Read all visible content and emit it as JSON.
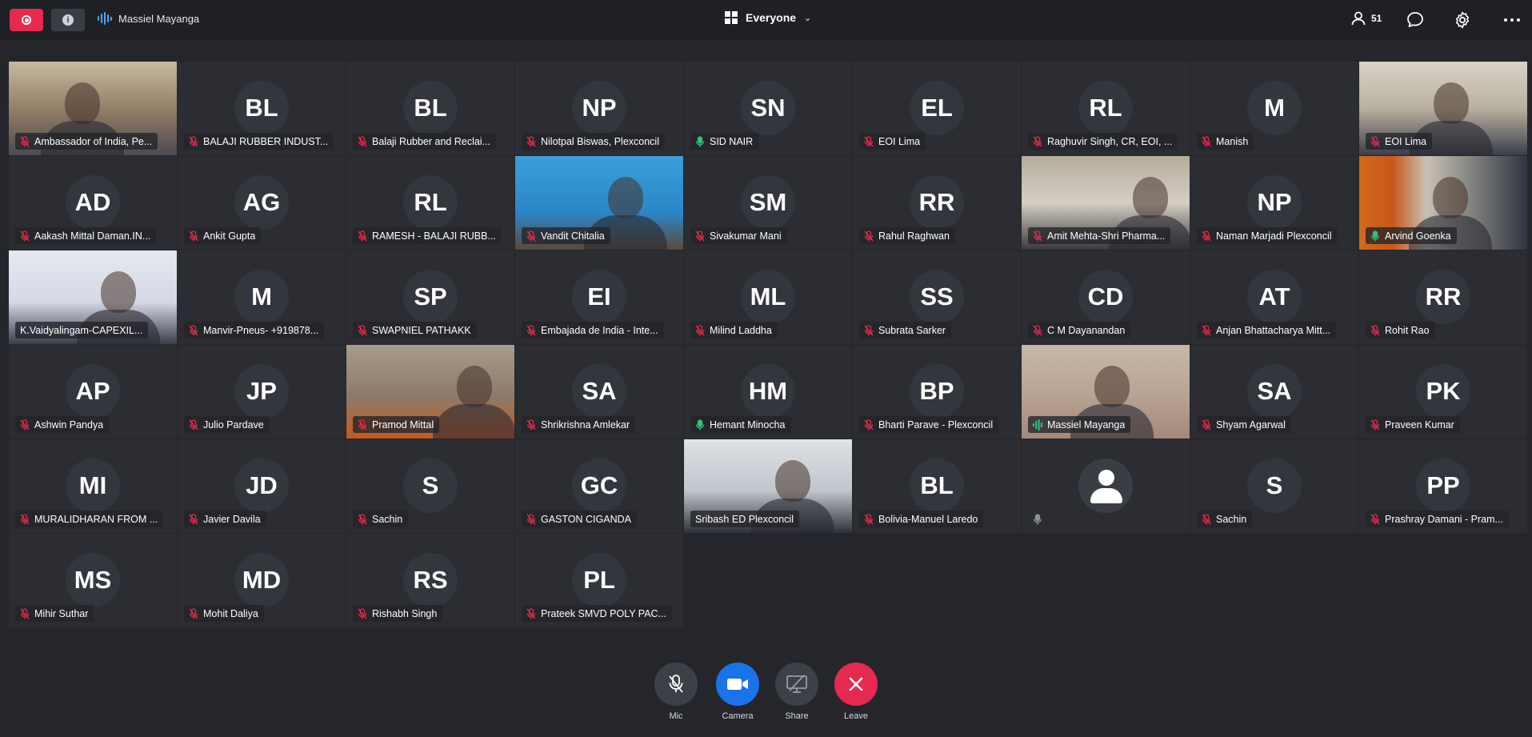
{
  "topbar": {
    "active_speaker": "Massiel Mayanga",
    "view_label": "Everyone",
    "participant_count": "51"
  },
  "colors": {
    "record": "#e5294f",
    "camera": "#1a73e8",
    "leave": "#e5294f",
    "muted_mic": "#e5294f",
    "active_mic": "#2ec27e"
  },
  "tiles": [
    {
      "initials": "",
      "name": "Ambassador of India, Pe...",
      "mic": "muted",
      "video": true
    },
    {
      "initials": "BL",
      "name": "BALAJI RUBBER INDUST...",
      "mic": "muted",
      "video": false
    },
    {
      "initials": "BL",
      "name": "Balaji Rubber and Reclai...",
      "mic": "muted",
      "video": false
    },
    {
      "initials": "NP",
      "name": "Nilotpal Biswas, Plexconcil",
      "mic": "muted",
      "video": false
    },
    {
      "initials": "SN",
      "name": "SID NAIR",
      "mic": "on",
      "video": false
    },
    {
      "initials": "EL",
      "name": "EOI Lima",
      "mic": "muted",
      "video": false
    },
    {
      "initials": "RL",
      "name": "Raghuvir Singh, CR, EOI, ...",
      "mic": "muted",
      "video": false
    },
    {
      "initials": "M",
      "name": "Manish",
      "mic": "muted",
      "video": false
    },
    {
      "initials": "",
      "name": "EOI Lima",
      "mic": "muted",
      "video": true
    },
    {
      "initials": "AD",
      "name": "Aakash Mittal Daman.IN...",
      "mic": "muted",
      "video": false
    },
    {
      "initials": "AG",
      "name": "Ankit Gupta",
      "mic": "muted",
      "video": false
    },
    {
      "initials": "RL",
      "name": "RAMESH - BALAJI RUBB...",
      "mic": "muted",
      "video": false
    },
    {
      "initials": "",
      "name": "Vandit Chitalia",
      "mic": "muted",
      "video": true
    },
    {
      "initials": "SM",
      "name": "Sivakumar Mani",
      "mic": "muted",
      "video": false
    },
    {
      "initials": "RR",
      "name": "Rahul Raghwan",
      "mic": "muted",
      "video": false
    },
    {
      "initials": "",
      "name": "Amit Mehta-Shri Pharma...",
      "mic": "muted",
      "video": true
    },
    {
      "initials": "NP",
      "name": "Naman Marjadi Plexconcil",
      "mic": "muted",
      "video": false
    },
    {
      "initials": "",
      "name": "Arvind Goenka",
      "mic": "on",
      "video": true
    },
    {
      "initials": "",
      "name": "K.Vaidyalingam-CAPEXIL...",
      "mic": "none",
      "video": true
    },
    {
      "initials": "M",
      "name": "Manvir-Pneus- +919878...",
      "mic": "muted",
      "video": false
    },
    {
      "initials": "SP",
      "name": "SWAPNIEL PATHAKK",
      "mic": "muted",
      "video": false
    },
    {
      "initials": "EI",
      "name": "Embajada de India - Inte...",
      "mic": "muted",
      "video": false
    },
    {
      "initials": "ML",
      "name": "Milind Laddha",
      "mic": "muted",
      "video": false
    },
    {
      "initials": "SS",
      "name": "Subrata Sarker",
      "mic": "muted",
      "video": false
    },
    {
      "initials": "CD",
      "name": "C M Dayanandan",
      "mic": "muted",
      "video": false
    },
    {
      "initials": "AT",
      "name": "Anjan Bhattacharya Mitt...",
      "mic": "muted",
      "video": false
    },
    {
      "initials": "RR",
      "name": "Rohit Rao",
      "mic": "muted",
      "video": false
    },
    {
      "initials": "AP",
      "name": "Ashwin Pandya",
      "mic": "muted",
      "video": false
    },
    {
      "initials": "JP",
      "name": "Julio Pardave",
      "mic": "muted",
      "video": false
    },
    {
      "initials": "",
      "name": "Pramod Mittal",
      "mic": "muted",
      "video": true
    },
    {
      "initials": "SA",
      "name": "Shrikrishna Amlekar",
      "mic": "muted",
      "video": false
    },
    {
      "initials": "HM",
      "name": "Hemant Minocha",
      "mic": "on",
      "video": false
    },
    {
      "initials": "BP",
      "name": "Bharti Parave - Plexconcil",
      "mic": "muted",
      "video": false
    },
    {
      "initials": "",
      "name": "Massiel Mayanga",
      "mic": "speaking",
      "video": true
    },
    {
      "initials": "SA",
      "name": "Shyam Agarwal",
      "mic": "muted",
      "video": false
    },
    {
      "initials": "PK",
      "name": "Praveen Kumar",
      "mic": "muted",
      "video": false
    },
    {
      "initials": "MI",
      "name": "MURALIDHARAN FROM ...",
      "mic": "muted",
      "video": false
    },
    {
      "initials": "JD",
      "name": "Javier Davila",
      "mic": "muted",
      "video": false
    },
    {
      "initials": "S",
      "name": "Sachin",
      "mic": "muted",
      "video": false
    },
    {
      "initials": "GC",
      "name": "GASTON CIGANDA",
      "mic": "muted",
      "video": false
    },
    {
      "initials": "",
      "name": "Sribash ED Plexconcil",
      "mic": "none",
      "video": true
    },
    {
      "initials": "BL",
      "name": "Bolivia-Manuel Laredo",
      "mic": "muted",
      "video": false
    },
    {
      "initials": "",
      "name": "",
      "mic": "grey",
      "video": false,
      "generic": true
    },
    {
      "initials": "S",
      "name": "Sachin",
      "mic": "muted",
      "video": false
    },
    {
      "initials": "PP",
      "name": "Prashray Damani - Pram...",
      "mic": "muted",
      "video": false
    },
    {
      "initials": "MS",
      "name": "Mihir Suthar",
      "mic": "muted",
      "video": false
    },
    {
      "initials": "MD",
      "name": "Mohit Daliya",
      "mic": "muted",
      "video": false
    },
    {
      "initials": "RS",
      "name": "Rishabh Singh",
      "mic": "muted",
      "video": false
    },
    {
      "initials": "PL",
      "name": "Prateek SMVD POLY PAC...",
      "mic": "muted",
      "video": false
    }
  ],
  "controls": {
    "mic_label": "Mic",
    "camera_label": "Camera",
    "share_label": "Share",
    "leave_label": "Leave"
  }
}
